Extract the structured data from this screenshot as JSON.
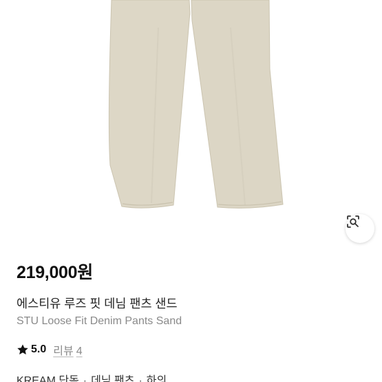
{
  "product": {
    "image_alt": "STU Loose Fit Denim Pants Sand",
    "price": "219,000원",
    "name_ko": "에스티유 루즈 핏 데님 팬츠 샌드",
    "name_en": "STU Loose Fit Denim Pants Sand",
    "rating": "5.0",
    "review_label": "리뷰",
    "review_count": "4",
    "categories": [
      "KREAM 단독",
      "데님 팬츠",
      "하의"
    ],
    "category_separator": "·"
  },
  "icons": {
    "lens": "lens-search-icon",
    "star": "star-icon"
  },
  "colors": {
    "pants": "#ddd7c6",
    "pants_shadow": "#cbc4b0",
    "text_primary": "#111111",
    "text_secondary": "#8a8a8a"
  }
}
